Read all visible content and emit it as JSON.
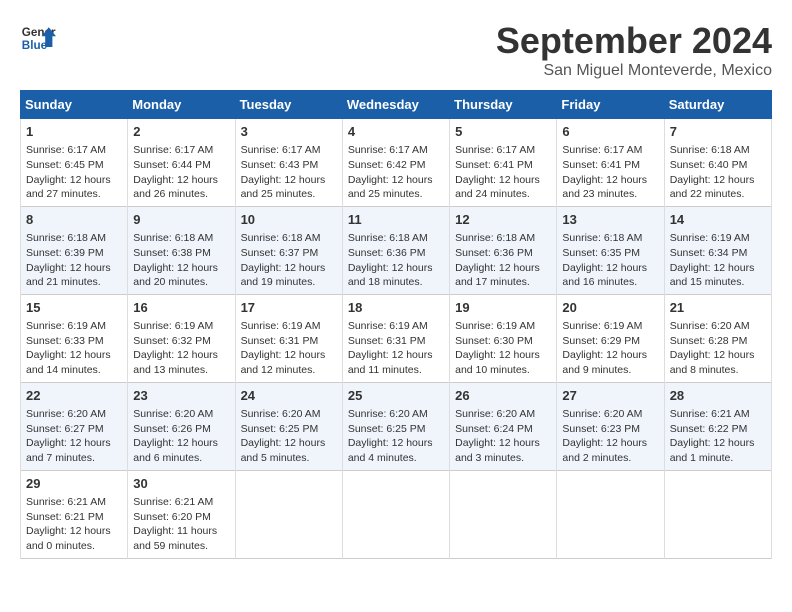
{
  "header": {
    "logo_general": "General",
    "logo_blue": "Blue",
    "month": "September 2024",
    "location": "San Miguel Monteverde, Mexico"
  },
  "weekdays": [
    "Sunday",
    "Monday",
    "Tuesday",
    "Wednesday",
    "Thursday",
    "Friday",
    "Saturday"
  ],
  "weeks": [
    [
      {
        "day": "1",
        "info": "Sunrise: 6:17 AM\nSunset: 6:45 PM\nDaylight: 12 hours\nand 27 minutes."
      },
      {
        "day": "2",
        "info": "Sunrise: 6:17 AM\nSunset: 6:44 PM\nDaylight: 12 hours\nand 26 minutes."
      },
      {
        "day": "3",
        "info": "Sunrise: 6:17 AM\nSunset: 6:43 PM\nDaylight: 12 hours\nand 25 minutes."
      },
      {
        "day": "4",
        "info": "Sunrise: 6:17 AM\nSunset: 6:42 PM\nDaylight: 12 hours\nand 25 minutes."
      },
      {
        "day": "5",
        "info": "Sunrise: 6:17 AM\nSunset: 6:41 PM\nDaylight: 12 hours\nand 24 minutes."
      },
      {
        "day": "6",
        "info": "Sunrise: 6:17 AM\nSunset: 6:41 PM\nDaylight: 12 hours\nand 23 minutes."
      },
      {
        "day": "7",
        "info": "Sunrise: 6:18 AM\nSunset: 6:40 PM\nDaylight: 12 hours\nand 22 minutes."
      }
    ],
    [
      {
        "day": "8",
        "info": "Sunrise: 6:18 AM\nSunset: 6:39 PM\nDaylight: 12 hours\nand 21 minutes."
      },
      {
        "day": "9",
        "info": "Sunrise: 6:18 AM\nSunset: 6:38 PM\nDaylight: 12 hours\nand 20 minutes."
      },
      {
        "day": "10",
        "info": "Sunrise: 6:18 AM\nSunset: 6:37 PM\nDaylight: 12 hours\nand 19 minutes."
      },
      {
        "day": "11",
        "info": "Sunrise: 6:18 AM\nSunset: 6:36 PM\nDaylight: 12 hours\nand 18 minutes."
      },
      {
        "day": "12",
        "info": "Sunrise: 6:18 AM\nSunset: 6:36 PM\nDaylight: 12 hours\nand 17 minutes."
      },
      {
        "day": "13",
        "info": "Sunrise: 6:18 AM\nSunset: 6:35 PM\nDaylight: 12 hours\nand 16 minutes."
      },
      {
        "day": "14",
        "info": "Sunrise: 6:19 AM\nSunset: 6:34 PM\nDaylight: 12 hours\nand 15 minutes."
      }
    ],
    [
      {
        "day": "15",
        "info": "Sunrise: 6:19 AM\nSunset: 6:33 PM\nDaylight: 12 hours\nand 14 minutes."
      },
      {
        "day": "16",
        "info": "Sunrise: 6:19 AM\nSunset: 6:32 PM\nDaylight: 12 hours\nand 13 minutes."
      },
      {
        "day": "17",
        "info": "Sunrise: 6:19 AM\nSunset: 6:31 PM\nDaylight: 12 hours\nand 12 minutes."
      },
      {
        "day": "18",
        "info": "Sunrise: 6:19 AM\nSunset: 6:31 PM\nDaylight: 12 hours\nand 11 minutes."
      },
      {
        "day": "19",
        "info": "Sunrise: 6:19 AM\nSunset: 6:30 PM\nDaylight: 12 hours\nand 10 minutes."
      },
      {
        "day": "20",
        "info": "Sunrise: 6:19 AM\nSunset: 6:29 PM\nDaylight: 12 hours\nand 9 minutes."
      },
      {
        "day": "21",
        "info": "Sunrise: 6:20 AM\nSunset: 6:28 PM\nDaylight: 12 hours\nand 8 minutes."
      }
    ],
    [
      {
        "day": "22",
        "info": "Sunrise: 6:20 AM\nSunset: 6:27 PM\nDaylight: 12 hours\nand 7 minutes."
      },
      {
        "day": "23",
        "info": "Sunrise: 6:20 AM\nSunset: 6:26 PM\nDaylight: 12 hours\nand 6 minutes."
      },
      {
        "day": "24",
        "info": "Sunrise: 6:20 AM\nSunset: 6:25 PM\nDaylight: 12 hours\nand 5 minutes."
      },
      {
        "day": "25",
        "info": "Sunrise: 6:20 AM\nSunset: 6:25 PM\nDaylight: 12 hours\nand 4 minutes."
      },
      {
        "day": "26",
        "info": "Sunrise: 6:20 AM\nSunset: 6:24 PM\nDaylight: 12 hours\nand 3 minutes."
      },
      {
        "day": "27",
        "info": "Sunrise: 6:20 AM\nSunset: 6:23 PM\nDaylight: 12 hours\nand 2 minutes."
      },
      {
        "day": "28",
        "info": "Sunrise: 6:21 AM\nSunset: 6:22 PM\nDaylight: 12 hours\nand 1 minute."
      }
    ],
    [
      {
        "day": "29",
        "info": "Sunrise: 6:21 AM\nSunset: 6:21 PM\nDaylight: 12 hours\nand 0 minutes."
      },
      {
        "day": "30",
        "info": "Sunrise: 6:21 AM\nSunset: 6:20 PM\nDaylight: 11 hours\nand 59 minutes."
      },
      {
        "day": "",
        "info": ""
      },
      {
        "day": "",
        "info": ""
      },
      {
        "day": "",
        "info": ""
      },
      {
        "day": "",
        "info": ""
      },
      {
        "day": "",
        "info": ""
      }
    ]
  ]
}
